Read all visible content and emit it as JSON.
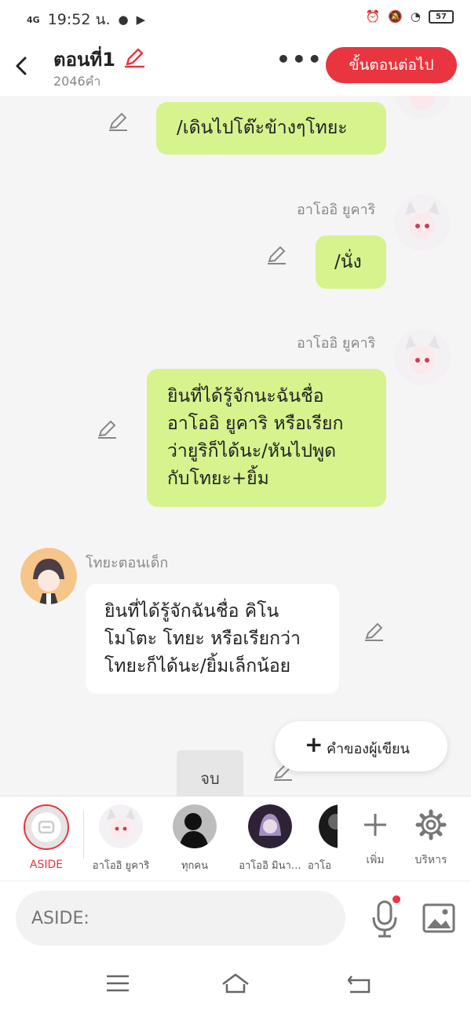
{
  "status_bar": {
    "network": "4G",
    "time": "19:52 น.",
    "battery": "57"
  },
  "header": {
    "title": "ตอนที่1",
    "word_count": "2046คำ",
    "more": "•••",
    "next_button": "ขั้นตอนต่อไป"
  },
  "messages": [
    {
      "side": "right",
      "speaker": "",
      "text": "/เดินไปโต๊ะข้างๆโทยะ"
    },
    {
      "side": "right",
      "speaker": "อาโออิ ยูคาริ",
      "text": "/นั่ง"
    },
    {
      "side": "right",
      "speaker": "อาโออิ ยูคาริ",
      "lines": [
        "ยินที่ได้รู้จักนะฉันชื่อ",
        "อาโออิ ยูคาริ หรือเรียก",
        "ว่ายูริก็ได้นะ/หันไปพูด",
        "กับโทยะ+ยิ้ม"
      ]
    },
    {
      "side": "left",
      "speaker": "โทยะตอนเด็ก",
      "lines": [
        "ยินที่ได้รู้จักฉันชื่อ คิโน",
        "โมโตะ โทยะ หรือเรียกว่า",
        "โทยะก็ได้นะ/ยิ้มเล็กน้อย"
      ]
    }
  ],
  "writer_note_button": {
    "icon": "+",
    "label": "คำของผู้เขียน"
  },
  "end_button": "จบ",
  "character_bar": {
    "aside_label": "ASIDE",
    "characters": [
      "อาโออิ ยูคาริ",
      "ทุกคน",
      "อาโออิ มินา…",
      "อาโอ"
    ],
    "add_label": "เพิ่ม",
    "manage_label": "บริหาร"
  },
  "input": {
    "placeholder": "ASIDE:"
  },
  "colors": {
    "accent": "#e9353f",
    "bubble_green": "#d6f38e",
    "background": "#f5f5f5"
  }
}
